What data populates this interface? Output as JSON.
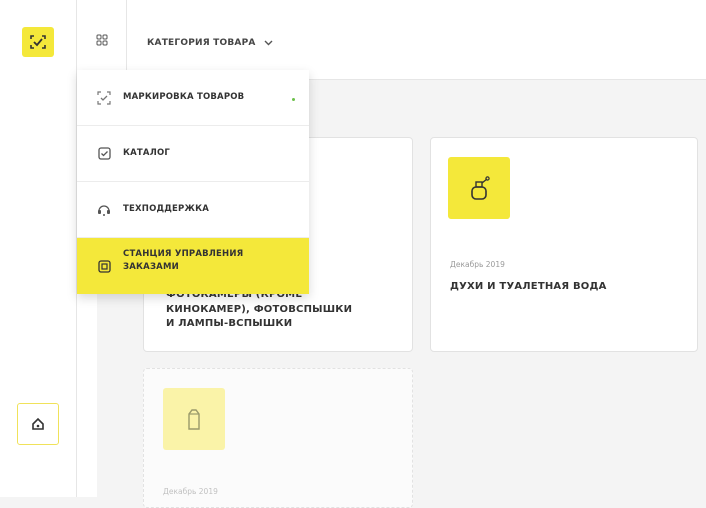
{
  "menu": {
    "items": [
      {
        "label": "МАРКИРОВКА ТОВАРОВ",
        "icon": "marking-icon"
      },
      {
        "label": "КАТАЛОГ",
        "icon": "catalog-icon"
      },
      {
        "label": "ТЕХПОДДЕРЖКА",
        "icon": "support-icon"
      },
      {
        "label_line1": "СТАНЦИЯ УПРАВЛЕНИЯ",
        "label_line2": "ЗАКАЗАМИ",
        "icon": "order-station-icon"
      }
    ]
  },
  "header": {
    "category_label": "КАТЕГОРИЯ ТОВАРА"
  },
  "cards": [
    {
      "title_line1": "ФОТОКАМЕРЫ (КРОМЕ",
      "title_line2": "КИНОКАМЕР), ФОТОВСПЫШКИ",
      "title_line3": "И ЛАМПЫ-ВСПЫШКИ"
    },
    {
      "date": "Декабрь 2019",
      "title": "ДУХИ И ТУАЛЕТНАЯ ВОДА"
    },
    {
      "date": "Декабрь 2019"
    }
  ],
  "colors": {
    "accent": "#f4e83a",
    "status_dot": "#6cc04a"
  }
}
